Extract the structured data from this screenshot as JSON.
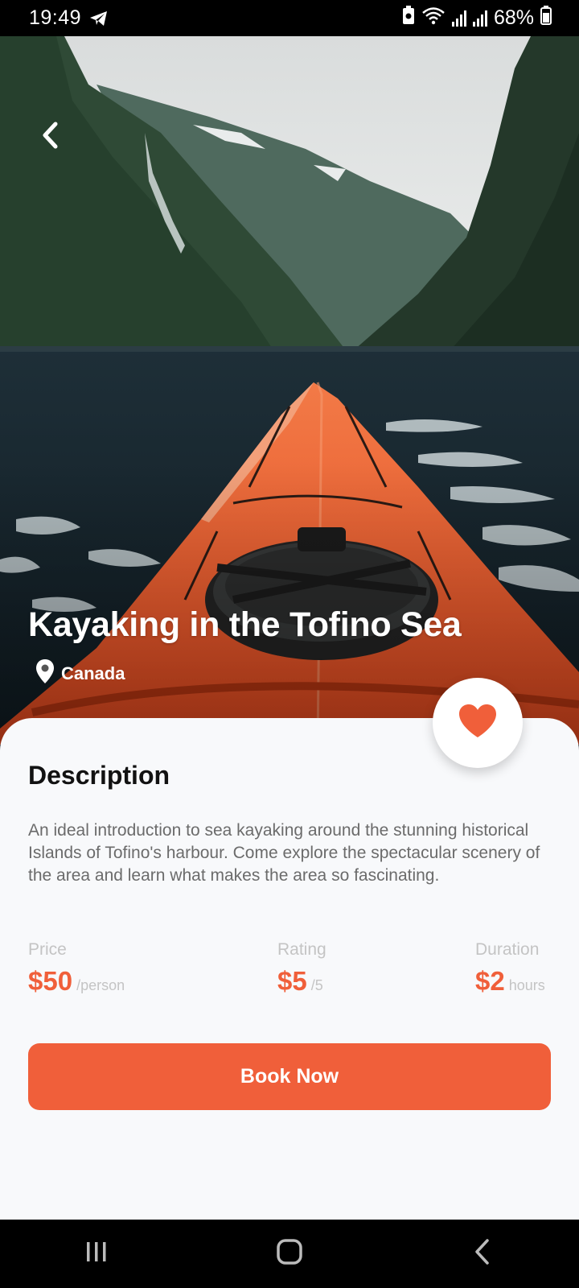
{
  "status_bar": {
    "time": "19:49",
    "battery": "68%",
    "icons": [
      "telegram-icon",
      "battery-saver-icon",
      "wifi-icon",
      "signal-icon",
      "signal-icon",
      "battery-icon"
    ]
  },
  "hero": {
    "title": "Kayaking in the Tofino Sea",
    "location": "Canada",
    "back_icon": "chevron-left-icon",
    "location_icon": "map-pin-icon"
  },
  "favorite": {
    "icon": "heart-icon",
    "color": "#f05f3a"
  },
  "description": {
    "title": "Description",
    "text": "An ideal introduction to sea kayaking around the stunning historical Islands of Tofino's harbour. Come explore the spectacular scenery of the area and learn what makes the area so fascinating."
  },
  "stats": {
    "price": {
      "label": "Price",
      "value": "$50",
      "unit": "/person"
    },
    "rating": {
      "label": "Rating",
      "value": "$5",
      "unit": "/5"
    },
    "duration": {
      "label": "Duration",
      "value": "$2",
      "unit": "hours"
    }
  },
  "book_button": {
    "label": "Book Now",
    "color": "#f05f3a"
  },
  "nav_bar": {
    "icons": [
      "recents-icon",
      "home-icon",
      "back-icon"
    ]
  }
}
